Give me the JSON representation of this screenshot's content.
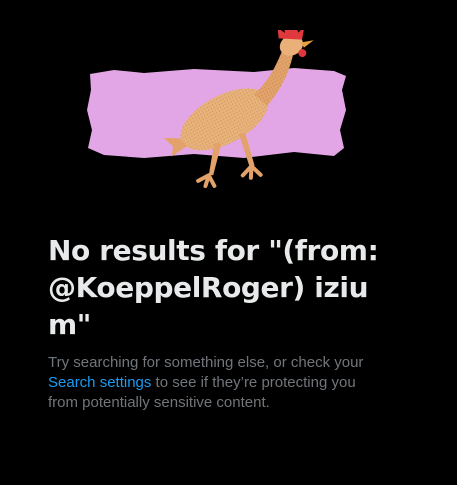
{
  "empty_state": {
    "title": "No results for \"(from:@KoeppelRoger) izium\"",
    "message_before_link": "Try searching for something else, or check your ",
    "link_label": "Search settings",
    "message_after_link": " to see if they’re protecting you from potentially sensitive content."
  },
  "colors": {
    "background": "#000000",
    "title": "#e7e9ea",
    "secondary_text": "#71767b",
    "link": "#1d9bf0",
    "illustration_backdrop": "#e2a6e6"
  },
  "icons": {
    "illustration": "rubber-chicken-illustration"
  }
}
